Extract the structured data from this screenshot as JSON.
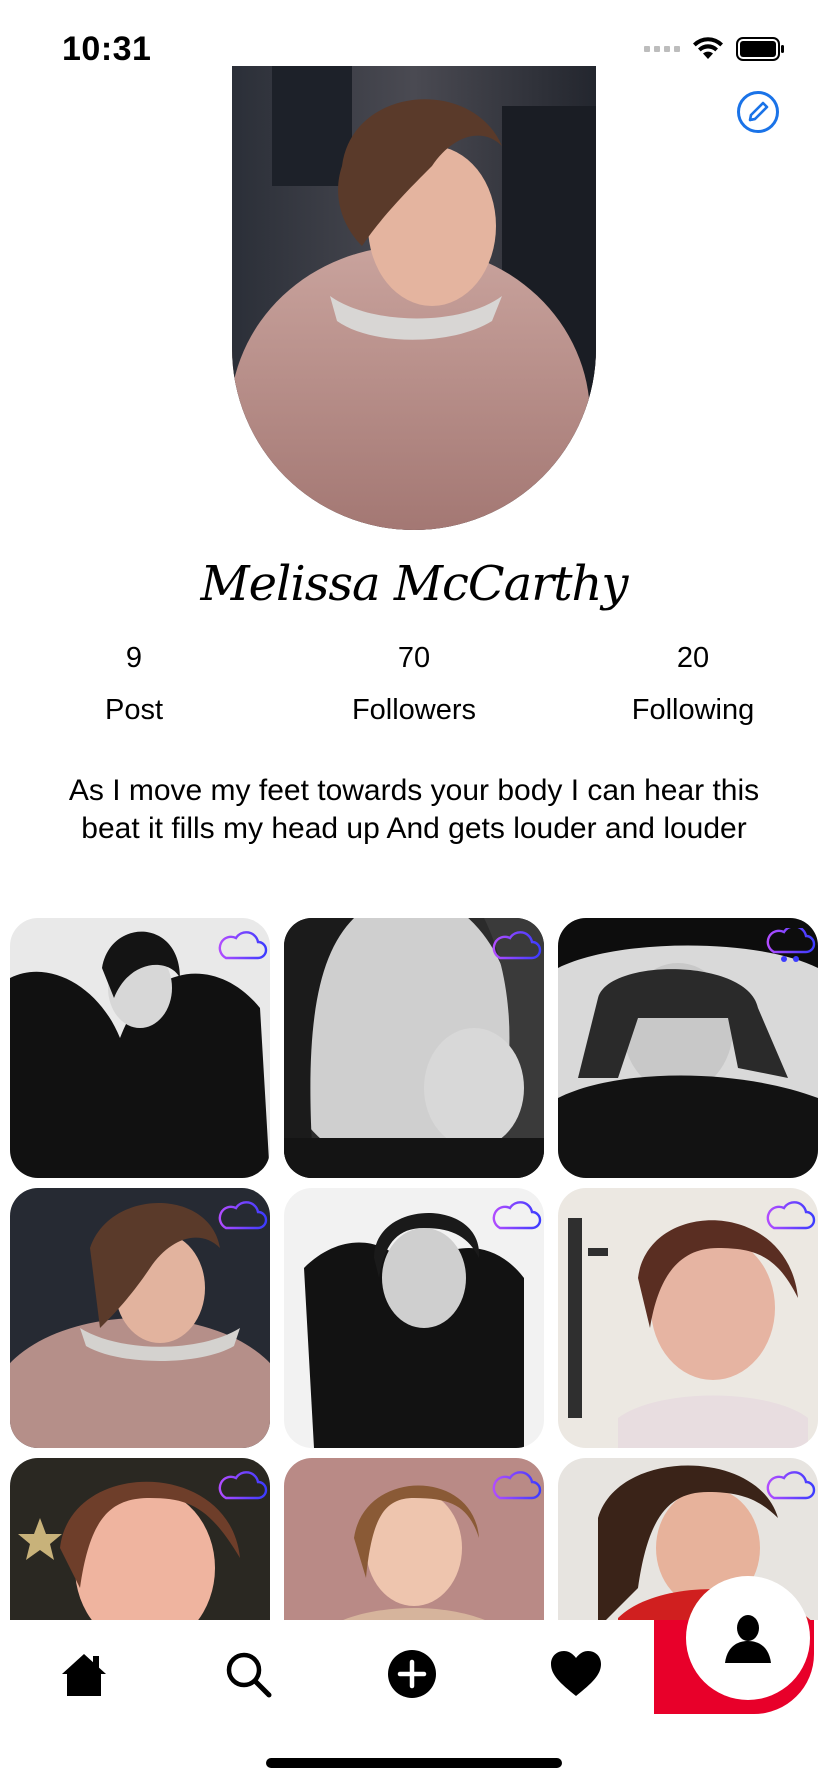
{
  "status_bar": {
    "time": "10:31",
    "icons": [
      "signal-dots-icon",
      "wifi-icon",
      "battery-icon"
    ]
  },
  "profile": {
    "name": "Melissa McCarthy",
    "avatar_desc": "profile photo",
    "edit_icon": "pencil-circle-icon",
    "stats": [
      {
        "value": "9",
        "label": "Post"
      },
      {
        "value": "70",
        "label": "Followers"
      },
      {
        "value": "20",
        "label": "Following"
      }
    ],
    "bio": "As I move my feet towards your body I can hear this beat it fills my head up And gets louder and louder"
  },
  "posts": [
    {
      "id": 1,
      "tone": "bw",
      "icon": "cloud-icon"
    },
    {
      "id": 2,
      "tone": "bw",
      "icon": "cloud-icon"
    },
    {
      "id": 3,
      "tone": "bw",
      "icon": "cloud-rain-icon"
    },
    {
      "id": 4,
      "tone": "color-pink",
      "icon": "cloud-icon"
    },
    {
      "id": 5,
      "tone": "bw",
      "icon": "cloud-icon"
    },
    {
      "id": 6,
      "tone": "color",
      "icon": "cloud-icon"
    },
    {
      "id": 7,
      "tone": "color",
      "icon": "cloud-icon"
    },
    {
      "id": 8,
      "tone": "color-beige",
      "icon": "cloud-icon"
    },
    {
      "id": 9,
      "tone": "color-red",
      "icon": "cloud-icon"
    }
  ],
  "bottom_nav": {
    "items": [
      {
        "icon": "home-icon"
      },
      {
        "icon": "search-icon"
      },
      {
        "icon": "add-circle-icon"
      },
      {
        "icon": "heart-icon"
      },
      {
        "icon": "profile-icon",
        "active": true
      }
    ]
  },
  "colors": {
    "accent_blue": "#1a73e8",
    "cloud_purple": "#8a2be2",
    "nav_active_red": "#e8002a"
  }
}
